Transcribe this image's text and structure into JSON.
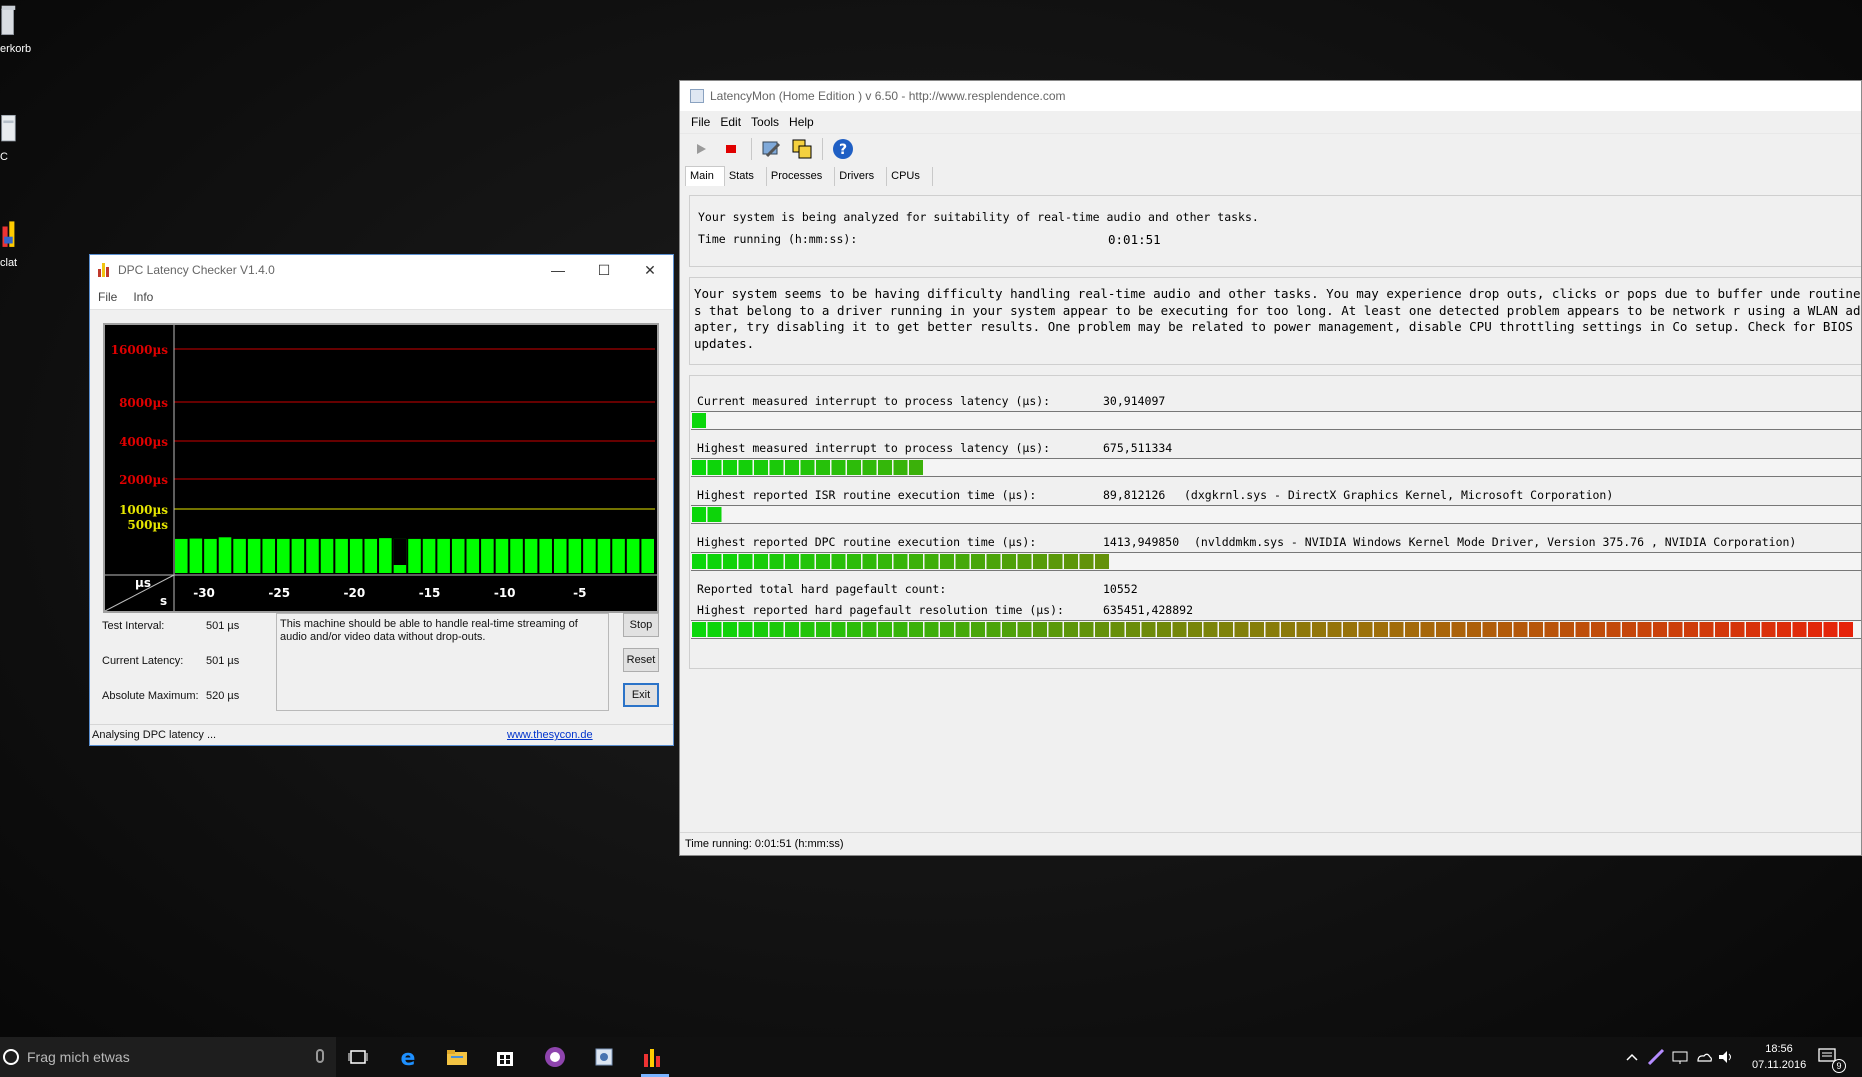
{
  "desktop": {
    "icons": [
      {
        "label": "erkorb"
      },
      {
        "label": "C"
      },
      {
        "label": "clat"
      }
    ]
  },
  "dpc": {
    "title": "DPC Latency Checker V1.4.0",
    "menu": [
      "File",
      "Info"
    ],
    "window_controls": {
      "minimize": "—",
      "maximize": "☐",
      "close": "✕"
    },
    "y_labels": [
      "16000µs",
      "8000µs",
      "4000µs",
      "2000µs",
      "1000µs",
      "500µs"
    ],
    "x_labels": [
      "-30",
      "-25",
      "-20",
      "-15",
      "-10",
      "-5"
    ],
    "axis_corner": {
      "top": "µs",
      "bottom": "s"
    },
    "fields": {
      "test_interval_label": "Test Interval:",
      "test_interval_value": "501 µs",
      "current_latency_label": "Current Latency:",
      "current_latency_value": "501 µs",
      "absolute_max_label": "Absolute Maximum:",
      "absolute_max_value": "520 µs"
    },
    "message": "This machine should be able to handle real-time streaming of audio and/or video data without drop-outs.",
    "buttons": {
      "stop": "Stop",
      "reset": "Reset",
      "exit": "Exit"
    },
    "status": "Analysing DPC latency ...",
    "link": "www.thesycon.de",
    "colors": {
      "bar": "#00ff00",
      "gridline_red": "#cc0000",
      "gridline_yellow": "#e6e600"
    }
  },
  "chart_data": {
    "type": "bar",
    "title": "",
    "xlabel": "s",
    "ylabel": "µs",
    "x": [
      -32,
      -31,
      -30,
      -29,
      -28,
      -27,
      -26,
      -25,
      -24,
      -23,
      -22,
      -21,
      -20,
      -19,
      -18,
      -17,
      -16,
      -15,
      -14,
      -13,
      -12,
      -11,
      -10,
      -9,
      -8,
      -7,
      -6,
      -5,
      -4,
      -3,
      -2,
      -1,
      0
    ],
    "values": [
      501,
      505,
      501,
      520,
      501,
      501,
      501,
      501,
      501,
      501,
      501,
      501,
      501,
      501,
      510,
      501,
      501,
      501,
      501,
      501,
      501,
      501,
      501,
      501,
      501,
      501,
      501,
      501,
      501,
      501,
      501,
      501,
      501
    ],
    "current_marker_index": 15,
    "y_ticks": [
      500,
      1000,
      2000,
      4000,
      8000,
      16000
    ],
    "grid": true
  },
  "latencymon": {
    "title": "LatencyMon  (Home Edition )  v 6.50 - http://www.resplendence.com",
    "menu": [
      "File",
      "Edit",
      "Tools",
      "Help"
    ],
    "toolbar_icons": [
      "play-icon",
      "stop-icon",
      "wrench-icon",
      "windows-icon",
      "help-icon"
    ],
    "tabs": [
      "Main",
      "Stats",
      "Processes",
      "Drivers",
      "CPUs"
    ],
    "active_tab": "Main",
    "analysis_line": "Your system is being analyzed for suitability of real-time audio and other tasks.",
    "time_running_label": "Time running (h:mm:ss):",
    "time_running_value": "0:01:51",
    "summary": "Your system seems to be having difficulty handling real-time audio and other tasks. You may experience drop outs, clicks or pops due to buffer unde routines that belong to a driver running in your system appear to be executing for too long. At least one detected problem appears to be network r using a WLAN adapter, try disabling it to get better results. One problem may be related to power management, disable CPU throttling settings in Co setup. Check for BIOS updates.",
    "metrics": [
      {
        "label": "Current measured interrupt to process latency (µs):",
        "value": "30,914097",
        "detail": "",
        "level": 0.012
      },
      {
        "label": "Highest measured interrupt to process latency (µs):",
        "value": "675,511334",
        "detail": "",
        "level": 0.195
      },
      {
        "label": "Highest reported ISR routine execution time (µs):",
        "value": "89,812126",
        "detail": "(dxgkrnl.sys - DirectX Graphics Kernel, Microsoft Corporation)",
        "level": 0.024
      },
      {
        "label": "Highest reported DPC routine execution time (µs):",
        "value": "1413,949850",
        "detail": "(nvlddmkm.sys - NVIDIA Windows Kernel Mode Driver, Version 375.76 , NVIDIA Corporation)",
        "level": 0.366
      },
      {
        "label": "Reported total hard pagefault count:",
        "value": "10552",
        "detail": "",
        "level": null
      },
      {
        "label": "Highest reported hard pagefault resolution time (µs):",
        "value": "635451,428892",
        "detail": "",
        "level": 1.0
      }
    ],
    "status": "Time running: 0:01:51  (h:mm:ss)"
  },
  "taskbar": {
    "search_placeholder": "Frag mich etwas",
    "apps": [
      "task-view-icon",
      "edge-icon",
      "file-explorer-icon",
      "store-icon",
      "app-icon",
      "latencymon-taskbar-icon",
      "dpc-taskbar-icon"
    ],
    "clock_time": "18:56",
    "clock_date": "07.11.2016",
    "notification_count": "9"
  }
}
